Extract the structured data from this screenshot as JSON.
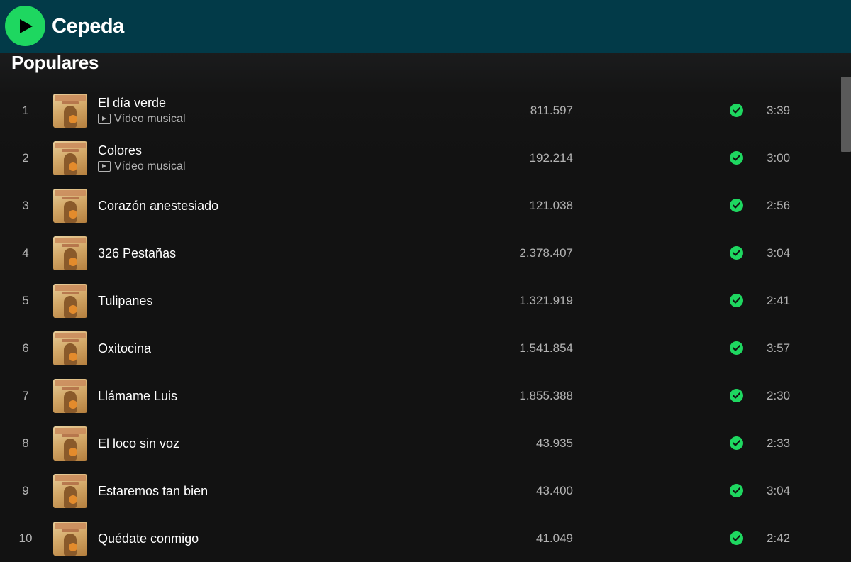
{
  "header": {
    "artist_name": "Cepeda",
    "play_icon": "play-icon"
  },
  "section": {
    "title": "Populares"
  },
  "tracks": [
    {
      "rank": "1",
      "title": "El día verde",
      "subtitle": "Vídeo musical",
      "plays": "811.597",
      "duration": "3:39"
    },
    {
      "rank": "2",
      "title": "Colores",
      "subtitle": "Vídeo musical",
      "plays": "192.214",
      "duration": "3:00"
    },
    {
      "rank": "3",
      "title": "Corazón anestesiado",
      "subtitle": "",
      "plays": "121.038",
      "duration": "2:56"
    },
    {
      "rank": "4",
      "title": "326 Pestañas",
      "subtitle": "",
      "plays": "2.378.407",
      "duration": "3:04"
    },
    {
      "rank": "5",
      "title": "Tulipanes",
      "subtitle": "",
      "plays": "1.321.919",
      "duration": "2:41"
    },
    {
      "rank": "6",
      "title": "Oxitocina",
      "subtitle": "",
      "plays": "1.541.854",
      "duration": "3:57"
    },
    {
      "rank": "7",
      "title": "Llámame Luis",
      "subtitle": "",
      "plays": "1.855.388",
      "duration": "2:30"
    },
    {
      "rank": "8",
      "title": "El loco sin voz",
      "subtitle": "",
      "plays": "43.935",
      "duration": "2:33"
    },
    {
      "rank": "9",
      "title": "Estaremos tan bien",
      "subtitle": "",
      "plays": "43.400",
      "duration": "3:04"
    },
    {
      "rank": "10",
      "title": "Quédate conmigo",
      "subtitle": "",
      "plays": "41.049",
      "duration": "2:42"
    }
  ],
  "icons": {
    "saved": "check-circle-icon",
    "video": "video-icon",
    "cover": "album-cover"
  },
  "colors": {
    "header_bg": "#023a48",
    "accent_green": "#1ed760",
    "background": "#121212",
    "muted_text": "#b3b3b3"
  }
}
